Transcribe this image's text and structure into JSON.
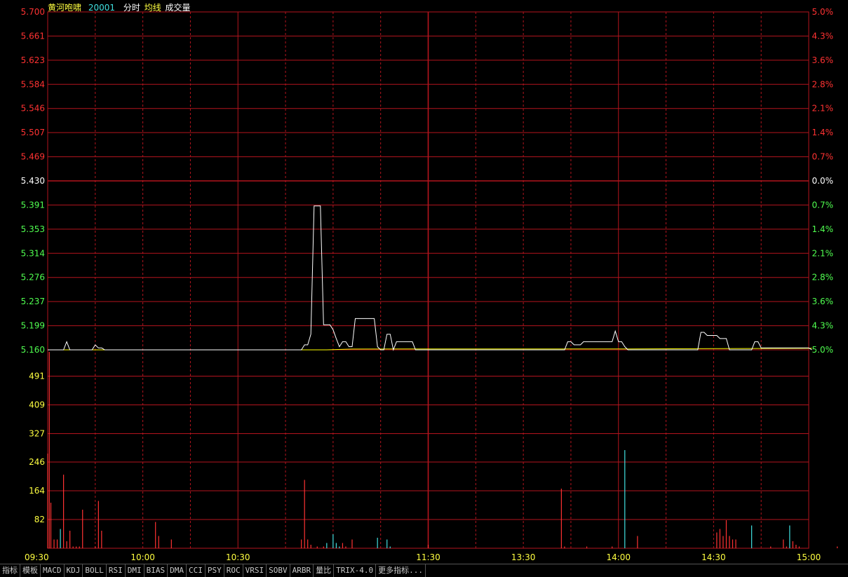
{
  "header": {
    "stock_name": "黄河咆啸",
    "stock_code": "20001",
    "mode_label": "分时",
    "avg_label": "均线",
    "volume_label": "成交量"
  },
  "chart_data": [
    {
      "type": "line",
      "name": "price",
      "prev_close": 5.43,
      "ylim": [
        5.16,
        5.7
      ],
      "y_ticks_left": [
        "5.700",
        "5.661",
        "5.623",
        "5.584",
        "5.546",
        "5.507",
        "5.469",
        "5.430",
        "5.391",
        "5.353",
        "5.314",
        "5.276",
        "5.237",
        "5.199",
        "5.160"
      ],
      "y_ticks_right": [
        "5.0%",
        "4.3%",
        "3.6%",
        "2.8%",
        "2.1%",
        "1.4%",
        "0.7%",
        "0.0%",
        "0.7%",
        "1.4%",
        "2.1%",
        "2.8%",
        "3.6%",
        "4.3%",
        "5.0%"
      ],
      "x_ticks": [
        "09:30",
        "10:00",
        "10:30",
        "11:30",
        "13:30",
        "14:00",
        "14:30",
        "15:00"
      ],
      "minute_range": [
        0,
        240
      ],
      "series": [
        {
          "points": [
            [
              0,
              5.16
            ],
            [
              5,
              5.16
            ],
            [
              6,
              5.173
            ],
            [
              7,
              5.16
            ],
            [
              14,
              5.16
            ],
            [
              15,
              5.168
            ],
            [
              16,
              5.163
            ],
            [
              17,
              5.163
            ],
            [
              18,
              5.16
            ],
            [
              80,
              5.16
            ],
            [
              81,
              5.168
            ],
            [
              82,
              5.168
            ],
            [
              83,
              5.185
            ],
            [
              84,
              5.39
            ],
            [
              86,
              5.39
            ],
            [
              87,
              5.2
            ],
            [
              89,
              5.2
            ],
            [
              90,
              5.192
            ],
            [
              91,
              5.178
            ],
            [
              92,
              5.165
            ],
            [
              93,
              5.173
            ],
            [
              94,
              5.173
            ],
            [
              95,
              5.165
            ],
            [
              96,
              5.165
            ],
            [
              97,
              5.21
            ],
            [
              103,
              5.21
            ],
            [
              104,
              5.165
            ],
            [
              105,
              5.16
            ],
            [
              106,
              5.16
            ],
            [
              107,
              5.185
            ],
            [
              108,
              5.185
            ],
            [
              109,
              5.16
            ],
            [
              110,
              5.173
            ],
            [
              115,
              5.173
            ],
            [
              116,
              5.16
            ],
            [
              163,
              5.16
            ],
            [
              164,
              5.173
            ],
            [
              165,
              5.173
            ],
            [
              166,
              5.168
            ],
            [
              168,
              5.168
            ],
            [
              169,
              5.173
            ],
            [
              178,
              5.173
            ],
            [
              179,
              5.19
            ],
            [
              180,
              5.173
            ],
            [
              181,
              5.173
            ],
            [
              182,
              5.165
            ],
            [
              183,
              5.16
            ],
            [
              205,
              5.16
            ],
            [
              206,
              5.188
            ],
            [
              207,
              5.188
            ],
            [
              208,
              5.183
            ],
            [
              211,
              5.183
            ],
            [
              212,
              5.178
            ],
            [
              214,
              5.178
            ],
            [
              215,
              5.16
            ],
            [
              222,
              5.16
            ],
            [
              223,
              5.173
            ],
            [
              224,
              5.173
            ],
            [
              225,
              5.163
            ],
            [
              240,
              5.163
            ],
            [
              241,
              5.16
            ]
          ]
        },
        {
          "points": [
            [
              0,
              5.16
            ],
            [
              88,
              5.16
            ],
            [
              96,
              5.1612
            ],
            [
              116,
              5.1615
            ],
            [
              183,
              5.1615
            ],
            [
              212,
              5.162
            ],
            [
              241,
              5.1625
            ]
          ]
        }
      ]
    },
    {
      "type": "bar",
      "name": "volume",
      "ylim": [
        0,
        573
      ],
      "y_ticks": [
        "491",
        "409",
        "327",
        "246",
        "164",
        "82"
      ],
      "bars": [
        [
          0,
          270,
          "up"
        ],
        [
          0.5,
          560,
          "up"
        ],
        [
          1,
          130,
          "up"
        ],
        [
          2,
          25,
          "up"
        ],
        [
          3,
          25,
          "up"
        ],
        [
          4,
          55,
          "flat"
        ],
        [
          5,
          210,
          "up"
        ],
        [
          6,
          20,
          "up"
        ],
        [
          7,
          50,
          "up"
        ],
        [
          8,
          5,
          "up"
        ],
        [
          9,
          5,
          "up"
        ],
        [
          10,
          5,
          "up"
        ],
        [
          11,
          110,
          "up"
        ],
        [
          15,
          5,
          "up"
        ],
        [
          16,
          135,
          "up"
        ],
        [
          17,
          50,
          "up"
        ],
        [
          34,
          75,
          "up"
        ],
        [
          35,
          35,
          "up"
        ],
        [
          39,
          25,
          "up"
        ],
        [
          80,
          25,
          "up"
        ],
        [
          81,
          195,
          "up"
        ],
        [
          82,
          25,
          "up"
        ],
        [
          83,
          10,
          "up"
        ],
        [
          85,
          5,
          "up"
        ],
        [
          87,
          5,
          "up"
        ],
        [
          88,
          15,
          "flat"
        ],
        [
          90,
          40,
          "flat"
        ],
        [
          91,
          15,
          "flat"
        ],
        [
          92,
          5,
          "flat"
        ],
        [
          93,
          15,
          "up"
        ],
        [
          94,
          5,
          "up"
        ],
        [
          96,
          25,
          "up"
        ],
        [
          104,
          30,
          "flat"
        ],
        [
          107,
          25,
          "flat"
        ],
        [
          108,
          5,
          "flat"
        ],
        [
          120,
          10,
          "up"
        ],
        [
          162,
          170,
          "up"
        ],
        [
          163,
          5,
          "up"
        ],
        [
          170,
          5,
          "up"
        ],
        [
          178,
          5,
          "up"
        ],
        [
          182,
          280,
          "flat"
        ],
        [
          186,
          35,
          "up"
        ],
        [
          211,
          45,
          "up"
        ],
        [
          212,
          55,
          "up"
        ],
        [
          213,
          35,
          "up"
        ],
        [
          214,
          80,
          "up"
        ],
        [
          215,
          35,
          "up"
        ],
        [
          216,
          25,
          "up"
        ],
        [
          217,
          25,
          "up"
        ],
        [
          222,
          65,
          "flat"
        ],
        [
          228,
          5,
          "up"
        ],
        [
          232,
          25,
          "up"
        ],
        [
          233,
          5,
          "up"
        ],
        [
          234,
          65,
          "flat"
        ],
        [
          235,
          20,
          "up"
        ],
        [
          236,
          10,
          "up"
        ],
        [
          237,
          5,
          "up"
        ],
        [
          249,
          5,
          "up"
        ]
      ]
    }
  ],
  "toolbar": {
    "items": [
      "指标",
      "模板",
      "MACD",
      "KDJ",
      "BOLL",
      "RSI",
      "DMI",
      "BIAS",
      "DMA",
      "CCI",
      "PSY",
      "ROC",
      "VRSI",
      "SOBV",
      "ARBR",
      "量比",
      "TRIX-4.0",
      "更多指标..."
    ]
  },
  "colors": {
    "grid": "#b4141e",
    "up": "#ff3232",
    "down": "#50ff50",
    "flat": "#ffffff",
    "label_yellow": "#ffff40",
    "label_cyan": "#40e0e0",
    "volume_up": "#ff3232",
    "volume_flat": "#40e0e0",
    "price_line": "#ffffff",
    "avg_line": "#ffff00"
  }
}
